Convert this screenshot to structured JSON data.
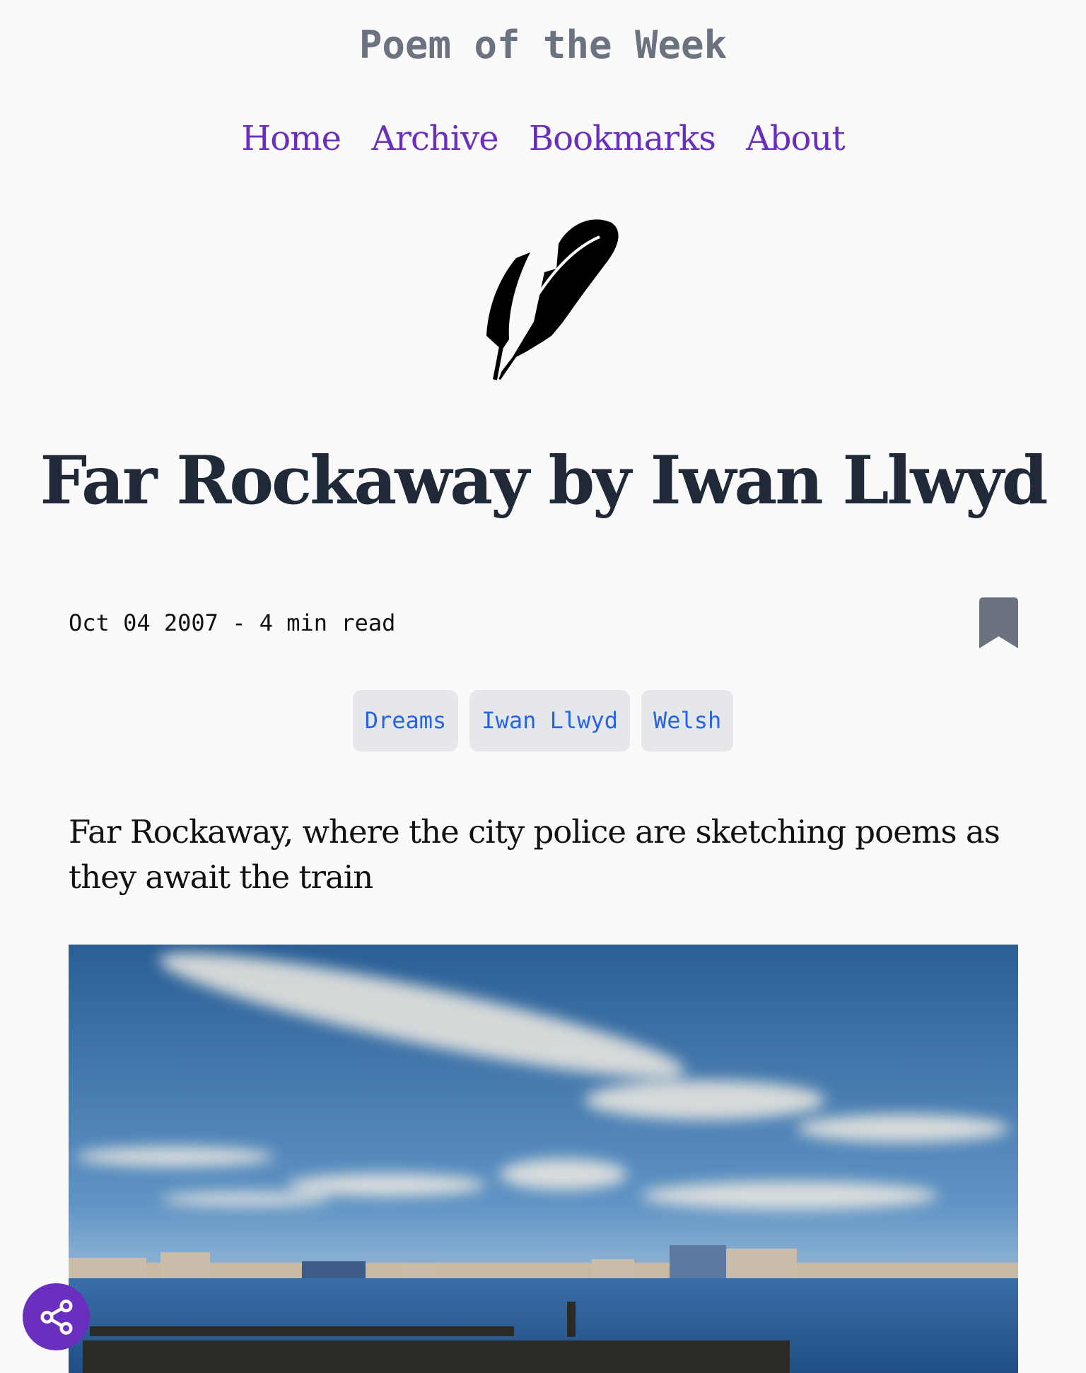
{
  "site": {
    "title": "Poem of the Week"
  },
  "nav": {
    "items": [
      {
        "label": "Home"
      },
      {
        "label": "Archive"
      },
      {
        "label": "Bookmarks"
      },
      {
        "label": "About"
      }
    ]
  },
  "post": {
    "title": "Far Rockaway by Iwan Llwyd",
    "meta": "Oct 04 2007 - 4 min read",
    "tags": [
      {
        "label": "Dreams"
      },
      {
        "label": "Iwan Llwyd"
      },
      {
        "label": "Welsh"
      }
    ],
    "lede": "Far Rockaway, where the city police are sketching poems as they await the train"
  },
  "icons": {
    "logo": "feather-icon",
    "bookmark": "bookmark-icon",
    "share": "share-icon"
  },
  "colors": {
    "accent": "#6b2fbf",
    "tag_text": "#2563eb",
    "tag_bg": "#e5e7eb",
    "muted": "#6b7280"
  }
}
